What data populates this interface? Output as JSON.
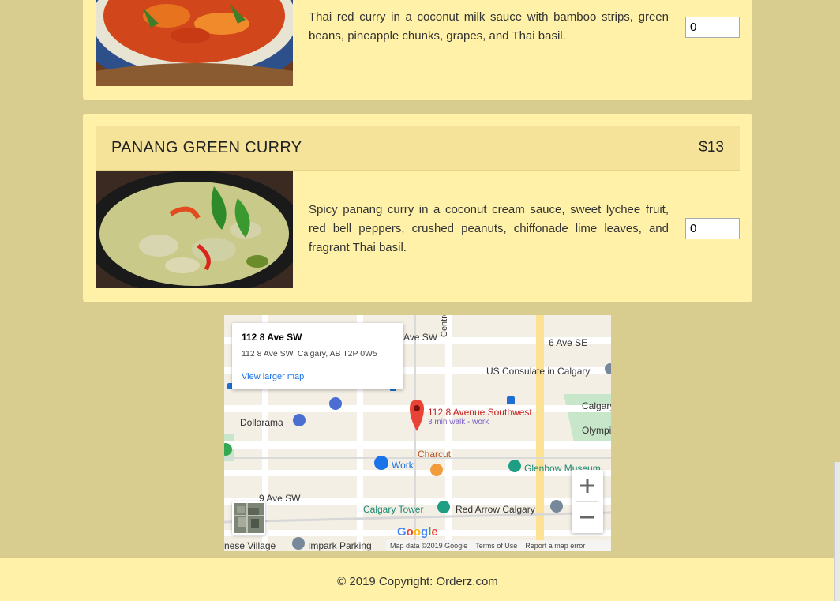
{
  "menu": {
    "items": [
      {
        "title": "",
        "price": "",
        "image": "red-curry-photo",
        "description": "Thai red curry in a coconut milk sauce with bamboo strips, green beans, pineapple chunks, grapes, and Thai basil.",
        "quantity": "0"
      },
      {
        "title": "PANANG GREEN CURRY",
        "price": "$13",
        "image": "green-curry-photo",
        "description": "Spicy panang curry in a coconut cream sauce, sweet lychee fruit, red bell peppers, crushed peanuts, chiffonade lime leaves, and fragrant Thai basil.",
        "quantity": "0"
      }
    ]
  },
  "map": {
    "info_title": "112 8 Ave SW",
    "info_address": "112 8 Ave SW, Calgary, AB T2P 0W5",
    "info_link": "View larger map",
    "marker_label": "112 8 Avenue Southwest",
    "marker_sub": "3 min walk - work",
    "places": {
      "dollarama": "Dollarama",
      "work": "Work",
      "charcut": "Charcut",
      "us_consulate": "US Consulate in Calgary",
      "glenbow": "Glenbow Museum",
      "calgary_tower": "Calgary Tower",
      "red_arrow": "Red Arrow Calgary",
      "impark": "Impark Parking",
      "chinese_village": "nese Village",
      "olympic": "Olympic Pl",
      "calgary_ci": "Calgary Ci"
    },
    "streets": {
      "ave_sw_top": "Ave SW",
      "ave_se": "6 Ave SE",
      "ave_9_sw": "9 Ave SW",
      "centre_st": "Centre St"
    },
    "google_logo": "Google",
    "attribution": {
      "data": "Map data ©2019 Google",
      "terms": "Terms of Use",
      "report": "Report a map error"
    },
    "colors": {
      "marker": "#ea4335",
      "link": "#1a73e8",
      "park": "#c8e6c9",
      "road_yellow": "#fde293"
    }
  },
  "footer": {
    "copyright": "© 2019 Copyright: Orderz.com"
  }
}
